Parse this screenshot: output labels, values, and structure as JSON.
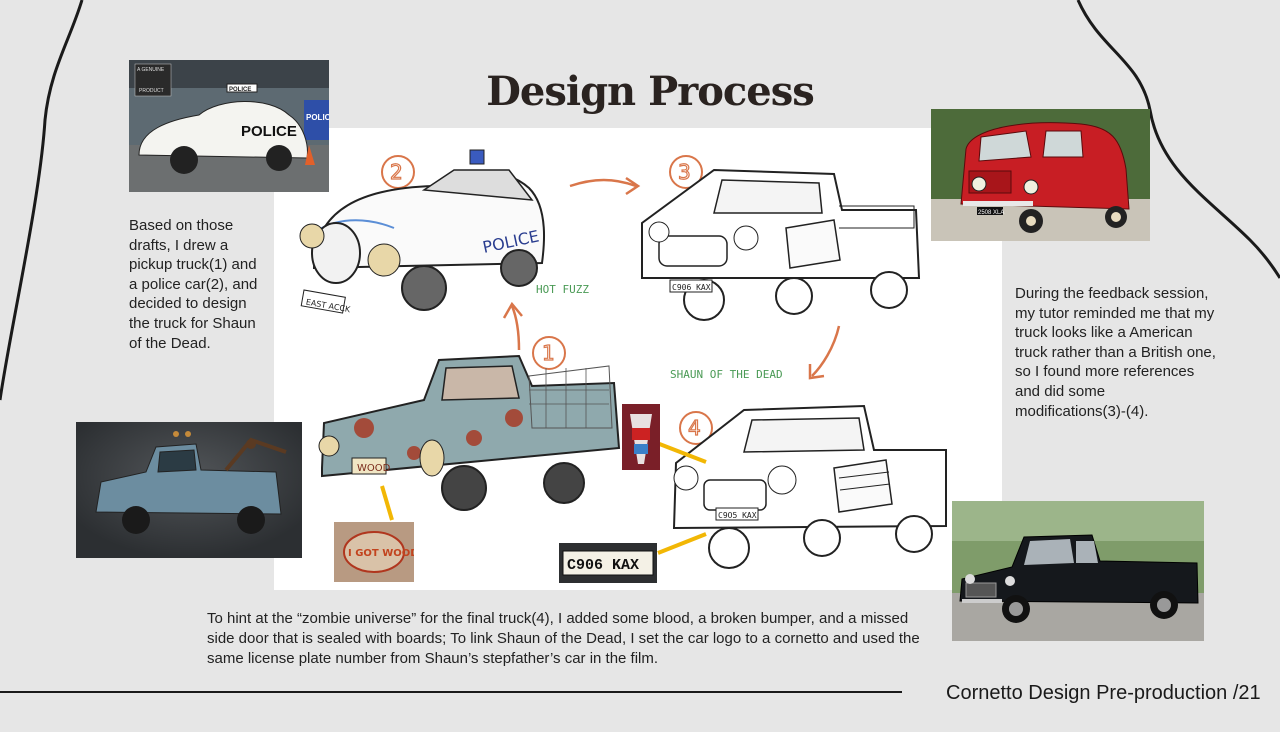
{
  "title": "Design Process",
  "left_text": "Based on those drafts, I drew a pickup truck(1) and a police car(2), and decided to design the truck for Shaun of the Dead.",
  "right_text": "During the feedback session, my tutor reminded me that my truck looks like a American truck rather than a British one, so I found more references and did some modifications(3)-(4).",
  "bottom_text": "To hint at the “zombie universe” for the final truck(4), I added some blood, a broken bumper, and a missed side door that is sealed with boards; To link Shaun of the Dead, I set the car logo to a cornetto and used the same license plate number from Shaun’s stepfather’s car in the film.",
  "footer": "Cornetto Design Pre-production /21",
  "sketch_labels": {
    "hot_fuzz": "HOT FUZZ",
    "shaun": "SHAUN OF THE DEAD",
    "step_1": "1",
    "step_2": "2",
    "step_3": "3",
    "step_4": "4"
  },
  "photo_text": {
    "police_sign": "POLICE",
    "police_door": "POLICE",
    "police_side": "POLICE",
    "badge_line1": "A GENUINE",
    "badge_line2": "PRODUCT",
    "red_plate": "2508 XLA",
    "plate_closeup": "C906 KAX",
    "i_got_wood": "I GOT WOOD"
  },
  "sketch_text": {
    "police_door": "POLICE",
    "police_plate": "EAST ACCK",
    "truck3_plate": "C906 KAX",
    "truck4_plate": "C9O5 KAX",
    "truck1_plate": "WOOD"
  },
  "colors": {
    "background": "#e6e6e6",
    "panel": "#ffffff",
    "arrow": "#d9764a",
    "callout": "#f2b705",
    "label_green": "#4a9a55"
  }
}
